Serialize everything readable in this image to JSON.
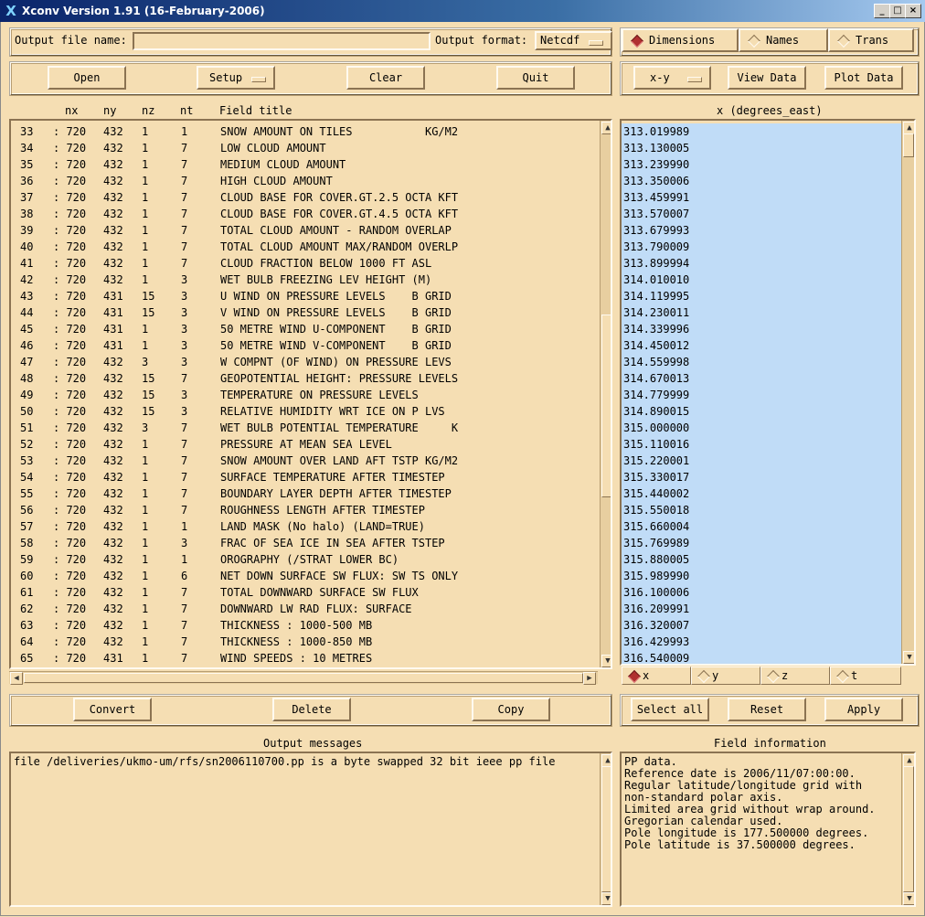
{
  "window": {
    "title": "Xconv Version 1.91 (16-February-2006)",
    "app_icon": "x-icon",
    "buttons": [
      "minimize-icon",
      "maximize-icon",
      "close-icon"
    ]
  },
  "output": {
    "file_label": "Output file name:",
    "file_value": "",
    "format_label": "Output format:",
    "format_value": "Netcdf"
  },
  "view_tabs": [
    {
      "label": "Dimensions",
      "selected": true
    },
    {
      "label": "Names",
      "selected": false
    },
    {
      "label": "Trans",
      "selected": false
    }
  ],
  "toolbar": {
    "open": "Open",
    "setup": "Setup",
    "clear": "Clear",
    "quit": "Quit"
  },
  "plot_toolbar": {
    "mode": "x-y",
    "view_data": "View Data",
    "plot_data": "Plot Data"
  },
  "field_list": {
    "headers": {
      "nx": "nx",
      "ny": "ny",
      "nz": "nz",
      "nt": "nt",
      "title": "Field title"
    },
    "rows": [
      [
        "33",
        ": 720",
        "432",
        "1",
        "1",
        "SNOW AMOUNT ON TILES           KG/M2"
      ],
      [
        "34",
        ": 720",
        "432",
        "1",
        "7",
        "LOW CLOUD AMOUNT"
      ],
      [
        "35",
        ": 720",
        "432",
        "1",
        "7",
        "MEDIUM CLOUD AMOUNT"
      ],
      [
        "36",
        ": 720",
        "432",
        "1",
        "7",
        "HIGH CLOUD AMOUNT"
      ],
      [
        "37",
        ": 720",
        "432",
        "1",
        "7",
        "CLOUD BASE FOR COVER.GT.2.5 OCTA KFT"
      ],
      [
        "38",
        ": 720",
        "432",
        "1",
        "7",
        "CLOUD BASE FOR COVER.GT.4.5 OCTA KFT"
      ],
      [
        "39",
        ": 720",
        "432",
        "1",
        "7",
        "TOTAL CLOUD AMOUNT - RANDOM OVERLAP"
      ],
      [
        "40",
        ": 720",
        "432",
        "1",
        "7",
        "TOTAL CLOUD AMOUNT MAX/RANDOM OVERLP"
      ],
      [
        "41",
        ": 720",
        "432",
        "1",
        "7",
        "CLOUD FRACTION BELOW 1000 FT ASL"
      ],
      [
        "42",
        ": 720",
        "432",
        "1",
        "3",
        "WET BULB FREEZING LEV HEIGHT (M)"
      ],
      [
        "43",
        ": 720",
        "431",
        "15",
        "3",
        "U WIND ON PRESSURE LEVELS    B GRID"
      ],
      [
        "44",
        ": 720",
        "431",
        "15",
        "3",
        "V WIND ON PRESSURE LEVELS    B GRID"
      ],
      [
        "45",
        ": 720",
        "431",
        "1",
        "3",
        "50 METRE WIND U-COMPONENT    B GRID"
      ],
      [
        "46",
        ": 720",
        "431",
        "1",
        "3",
        "50 METRE WIND V-COMPONENT    B GRID"
      ],
      [
        "47",
        ": 720",
        "432",
        "3",
        "3",
        "W COMPNT (OF WIND) ON PRESSURE LEVS"
      ],
      [
        "48",
        ": 720",
        "432",
        "15",
        "7",
        "GEOPOTENTIAL HEIGHT: PRESSURE LEVELS"
      ],
      [
        "49",
        ": 720",
        "432",
        "15",
        "3",
        "TEMPERATURE ON PRESSURE LEVELS"
      ],
      [
        "50",
        ": 720",
        "432",
        "15",
        "3",
        "RELATIVE HUMIDITY WRT ICE ON P LVS"
      ],
      [
        "51",
        ": 720",
        "432",
        "3",
        "7",
        "WET BULB POTENTIAL TEMPERATURE     K"
      ],
      [
        "52",
        ": 720",
        "432",
        "1",
        "7",
        "PRESSURE AT MEAN SEA LEVEL"
      ],
      [
        "53",
        ": 720",
        "432",
        "1",
        "7",
        "SNOW AMOUNT OVER LAND AFT TSTP KG/M2"
      ],
      [
        "54",
        ": 720",
        "432",
        "1",
        "7",
        "SURFACE TEMPERATURE AFTER TIMESTEP"
      ],
      [
        "55",
        ": 720",
        "432",
        "1",
        "7",
        "BOUNDARY LAYER DEPTH AFTER TIMESTEP"
      ],
      [
        "56",
        ": 720",
        "432",
        "1",
        "7",
        "ROUGHNESS LENGTH AFTER TIMESTEP"
      ],
      [
        "57",
        ": 720",
        "432",
        "1",
        "1",
        "LAND MASK (No halo) (LAND=TRUE)"
      ],
      [
        "58",
        ": 720",
        "432",
        "1",
        "3",
        "FRAC OF SEA ICE IN SEA AFTER TSTEP"
      ],
      [
        "59",
        ": 720",
        "432",
        "1",
        "1",
        "OROGRAPHY (/STRAT LOWER BC)"
      ],
      [
        "60",
        ": 720",
        "432",
        "1",
        "6",
        "NET DOWN SURFACE SW FLUX: SW TS ONLY"
      ],
      [
        "61",
        ": 720",
        "432",
        "1",
        "7",
        "TOTAL DOWNWARD SURFACE SW FLUX"
      ],
      [
        "62",
        ": 720",
        "432",
        "1",
        "7",
        "DOWNWARD LW RAD FLUX: SURFACE"
      ],
      [
        "63",
        ": 720",
        "432",
        "1",
        "7",
        "THICKNESS : 1000-500 MB"
      ],
      [
        "64",
        ": 720",
        "432",
        "1",
        "7",
        "THICKNESS : 1000-850 MB"
      ],
      [
        "65",
        ": 720",
        "431",
        "1",
        "7",
        "WIND SPEEDS : 10 METRES"
      ]
    ]
  },
  "dimension": {
    "title": "x (degrees_east)",
    "values": [
      "313.019989",
      "313.130005",
      "313.239990",
      "313.350006",
      "313.459991",
      "313.570007",
      "313.679993",
      "313.790009",
      "313.899994",
      "314.010010",
      "314.119995",
      "314.230011",
      "314.339996",
      "314.450012",
      "314.559998",
      "314.670013",
      "314.779999",
      "314.890015",
      "315.000000",
      "315.110016",
      "315.220001",
      "315.330017",
      "315.440002",
      "315.550018",
      "315.660004",
      "315.769989",
      "315.880005",
      "315.989990",
      "316.100006",
      "316.209991",
      "316.320007",
      "316.429993",
      "316.540009"
    ],
    "axes": [
      {
        "label": "x",
        "selected": true
      },
      {
        "label": "y",
        "selected": false
      },
      {
        "label": "z",
        "selected": false
      },
      {
        "label": "t",
        "selected": false
      }
    ],
    "highlight_color": "#c0dcf7"
  },
  "actions": {
    "convert": "Convert",
    "delete": "Delete",
    "copy": "Copy",
    "select_all": "Select all",
    "reset": "Reset",
    "apply": "Apply"
  },
  "messages": {
    "title": "Output messages",
    "text": "file /deliveries/ukmo-um/rfs/sn2006110700.pp is a byte swapped 32 bit ieee pp file"
  },
  "field_info": {
    "title": "Field information",
    "lines": [
      "PP data.",
      "Reference date is 2006/11/07:00:00.",
      "Regular latitude/longitude grid with",
      "non-standard polar axis.",
      "Limited area grid without wrap around.",
      "Gregorian calendar used.",
      "Pole longitude is 177.500000 degrees.",
      "Pole latitude is 37.500000 degrees."
    ]
  },
  "colors": {
    "background": "#f5deb3",
    "titlebar": "#0a246a"
  }
}
